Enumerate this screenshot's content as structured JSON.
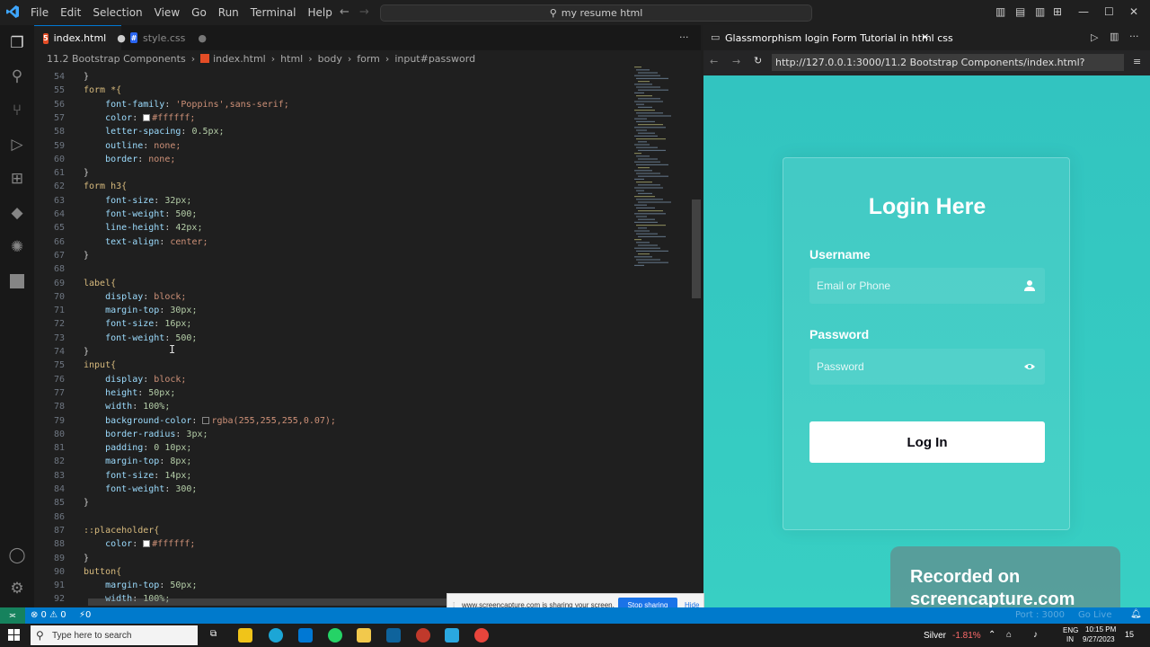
{
  "titlebar": {
    "menu": [
      "File",
      "Edit",
      "Selection",
      "View",
      "Go",
      "Run",
      "Terminal",
      "Help"
    ],
    "search": "my resume html"
  },
  "tabs": [
    {
      "label": "index.html",
      "active": true
    },
    {
      "label": "style.css",
      "active": false
    }
  ],
  "breadcrumb": [
    "11.2 Bootstrap Components",
    "index.html",
    "html",
    "body",
    "form",
    "input#password"
  ],
  "editor": {
    "lines": [
      {
        "n": "54",
        "t": "}"
      },
      {
        "n": "55",
        "t": "form *{"
      },
      {
        "n": "56",
        "t": "    font-family: 'Poppins',sans-serif;"
      },
      {
        "n": "57",
        "t": "    color: #ffffff;",
        "swatch": "#ffffff"
      },
      {
        "n": "58",
        "t": "    letter-spacing: 0.5px;"
      },
      {
        "n": "59",
        "t": "    outline: none;"
      },
      {
        "n": "60",
        "t": "    border: none;"
      },
      {
        "n": "61",
        "t": "}"
      },
      {
        "n": "62",
        "t": "form h3{"
      },
      {
        "n": "63",
        "t": "    font-size: 32px;"
      },
      {
        "n": "64",
        "t": "    font-weight: 500;"
      },
      {
        "n": "65",
        "t": "    line-height: 42px;"
      },
      {
        "n": "66",
        "t": "    text-align: center;"
      },
      {
        "n": "67",
        "t": "}"
      },
      {
        "n": "68",
        "t": ""
      },
      {
        "n": "69",
        "t": "label{"
      },
      {
        "n": "70",
        "t": "    display: block;"
      },
      {
        "n": "71",
        "t": "    margin-top: 30px;"
      },
      {
        "n": "72",
        "t": "    font-size: 16px;"
      },
      {
        "n": "73",
        "t": "    font-weight: 500;"
      },
      {
        "n": "74",
        "t": "}"
      },
      {
        "n": "75",
        "t": "input{"
      },
      {
        "n": "76",
        "t": "    display: block;"
      },
      {
        "n": "77",
        "t": "    height: 50px;"
      },
      {
        "n": "78",
        "t": "    width: 100%;"
      },
      {
        "n": "79",
        "t": "    background-color: rgba(255,255,255,0.07);",
        "swatch": "transparent"
      },
      {
        "n": "80",
        "t": "    border-radius: 3px;"
      },
      {
        "n": "81",
        "t": "    padding: 0 10px;"
      },
      {
        "n": "82",
        "t": "    margin-top: 8px;"
      },
      {
        "n": "83",
        "t": "    font-size: 14px;"
      },
      {
        "n": "84",
        "t": "    font-weight: 300;"
      },
      {
        "n": "85",
        "t": "}"
      },
      {
        "n": "86",
        "t": ""
      },
      {
        "n": "87",
        "t": "::placeholder{"
      },
      {
        "n": "88",
        "t": "    color: #ffffff;",
        "swatch": "#ffffff"
      },
      {
        "n": "89",
        "t": "}"
      },
      {
        "n": "90",
        "t": "button{"
      },
      {
        "n": "91",
        "t": "    margin-top: 50px;"
      },
      {
        "n": "92",
        "t": "    width: 100%;"
      }
    ]
  },
  "preview": {
    "tab_title": "Glassmorphism login Form Tutorial in html css",
    "url": "http://127.0.0.1:3000/11.2 Bootstrap Components/index.html?",
    "form": {
      "heading": "Login Here",
      "username_label": "Username",
      "username_placeholder": "Email or Phone",
      "password_label": "Password",
      "password_placeholder": "Password",
      "button": "Log In"
    },
    "watermark_line1": "Recorded on",
    "watermark_line2": "screencapture.com"
  },
  "sharebar": {
    "message": "www.screencapture.com is sharing your screen.",
    "stop": "Stop sharing",
    "hide": "Hide"
  },
  "statusbar": {
    "problems": "⊗ 0 ⚠ 0",
    "ports": "⚡0",
    "port_info": "Port : 3000",
    "go_live": "Go Live"
  },
  "taskbar": {
    "search_placeholder": "Type here to search",
    "weather": "Silver",
    "stock": "-1.81%",
    "lang1": "ENG",
    "lang2": "IN",
    "time": "10:15 PM",
    "date": "9/27/2023",
    "notif": "15"
  },
  "colors": {
    "accent": "#007acc",
    "preview_bg": "#35c9c2"
  }
}
